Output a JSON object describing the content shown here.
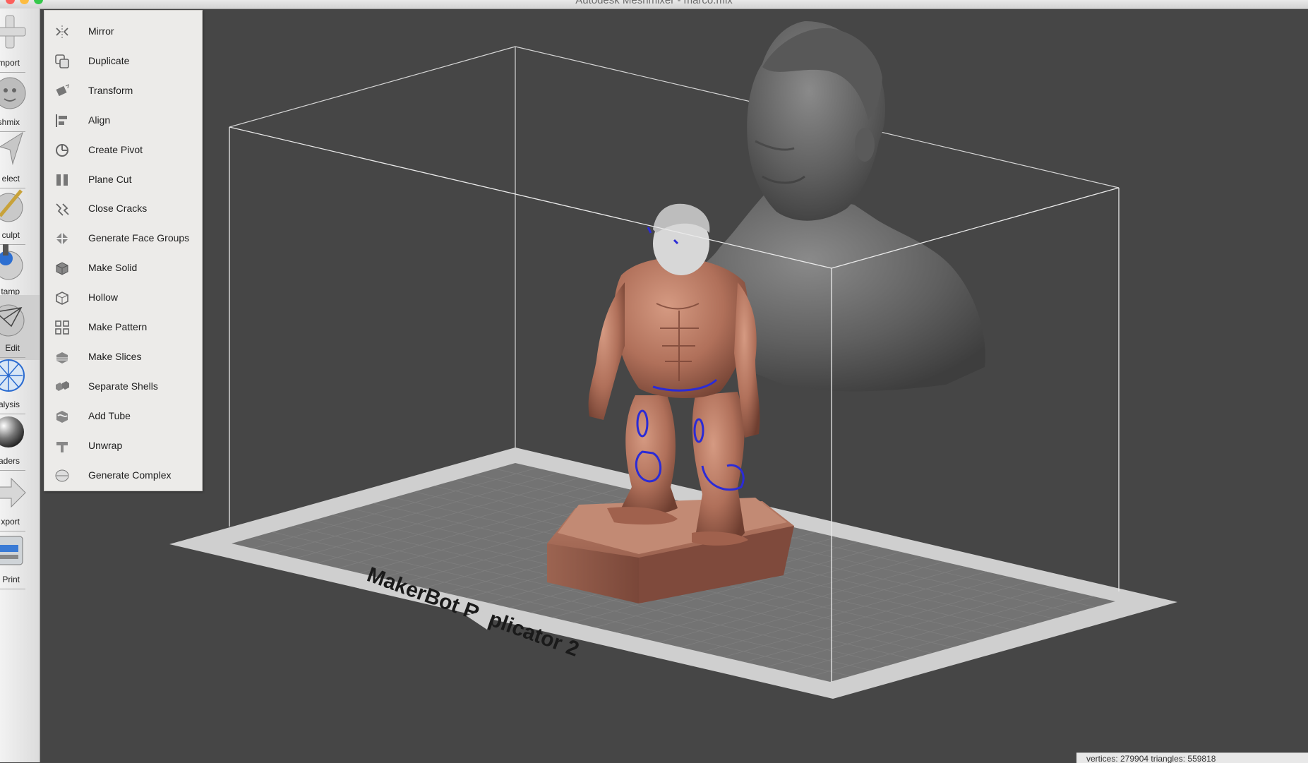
{
  "window": {
    "title": "Autodesk Meshmixer - marco.mix"
  },
  "toolbar": {
    "items": [
      {
        "label": "mport",
        "icon": "plus-icon"
      },
      {
        "label": "eshmix",
        "icon": "face-sphere-icon"
      },
      {
        "label": "elect",
        "icon": "arrow-cursor-icon"
      },
      {
        "label": "culpt",
        "icon": "sculpt-brush-icon"
      },
      {
        "label": "tamp",
        "icon": "stamp-icon"
      },
      {
        "label": "Edit",
        "icon": "edit-mesh-icon"
      },
      {
        "label": "alysis",
        "icon": "analysis-wireframe-icon"
      },
      {
        "label": "aders",
        "icon": "shader-sphere-icon"
      },
      {
        "label": "xport",
        "icon": "export-arrow-icon"
      },
      {
        "label": "Print",
        "icon": "printer-icon"
      }
    ]
  },
  "edit_menu": {
    "items": [
      {
        "label": "Mirror",
        "icon": "mirror-icon"
      },
      {
        "label": "Duplicate",
        "icon": "duplicate-icon"
      },
      {
        "label": "Transform",
        "icon": "transform-icon"
      },
      {
        "label": "Align",
        "icon": "align-icon"
      },
      {
        "label": "Create Pivot",
        "icon": "pivot-icon"
      },
      {
        "label": "Plane Cut",
        "icon": "plane-cut-icon"
      },
      {
        "label": "Close Cracks",
        "icon": "close-cracks-icon"
      },
      {
        "label": "Generate Face Groups",
        "icon": "face-groups-icon"
      },
      {
        "label": "Make Solid",
        "icon": "make-solid-icon"
      },
      {
        "label": "Hollow",
        "icon": "hollow-icon"
      },
      {
        "label": "Make Pattern",
        "icon": "pattern-icon"
      },
      {
        "label": "Make Slices",
        "icon": "slices-icon"
      },
      {
        "label": "Separate Shells",
        "icon": "separate-shells-icon"
      },
      {
        "label": "Add Tube",
        "icon": "tube-icon"
      },
      {
        "label": "Unwrap",
        "icon": "unwrap-icon"
      },
      {
        "label": "Generate Complex",
        "icon": "complex-icon"
      }
    ]
  },
  "viewport": {
    "printer_label": "MakerBot Replicator 2",
    "colors": {
      "background": "#464646",
      "model_terracotta": "#b0705a",
      "bust_gray": "#6e6e6e",
      "boundary_blue": "#2b2bd6"
    }
  },
  "status": {
    "text": "vertices: 279904 triangles: 559818"
  }
}
